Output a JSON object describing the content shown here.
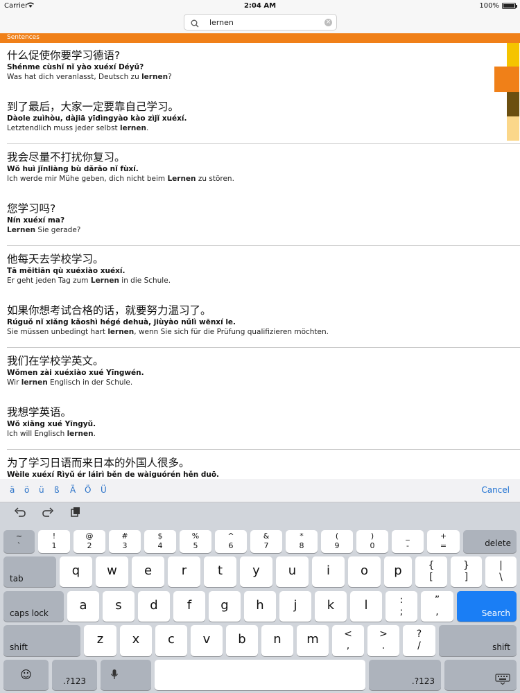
{
  "status": {
    "carrier": "Carrier",
    "time": "2:04 AM",
    "battery": "100%"
  },
  "search": {
    "value": "lernen"
  },
  "section": {
    "title": "Sentences"
  },
  "entries": [
    {
      "zh": "什么促使你要学习德语?",
      "py": "Shénme cùshǐ nǐ yào xuéxí  Déyǔ?",
      "de_pre": "Was hat dich veranlasst, Deutsch zu ",
      "de_bold": "lernen",
      "de_post": "?"
    },
    {
      "zh": "到了最后，大家一定要靠自己学习。",
      "py": "Dàole zuìhòu, dàjiā yīdìngyào kào zìjǐ xuéxí.",
      "de_pre": "Letztendlich muss jeder selbst ",
      "de_bold": "lernen",
      "de_post": "."
    },
    {
      "zh": "我会尽量不打扰你复习。",
      "py": "Wǒ huì jǐnliàng bù dǎrǎo nǐ fùxí.",
      "de_pre": "Ich werde mir Mühe geben, dich nicht beim ",
      "de_bold": "Lernen",
      "de_post": " zu stören."
    },
    {
      "zh": "您学习吗?",
      "py": "Nín xuéxí ma?",
      "de_pre": "",
      "de_bold": "Lernen",
      "de_post": " Sie gerade?"
    },
    {
      "zh": "他每天去学校学习。",
      "py": "Tā měitiān qù xuéxiào xuéxí.",
      "de_pre": "Er geht jeden Tag zum ",
      "de_bold": "Lernen",
      "de_post": " in die Schule."
    },
    {
      "zh": "如果你想考试合格的话，就要努力温习了。",
      "py": "Rúguǒ nǐ xiǎng kǎoshì hégé dehuà, jiùyào nǔlì wēnxí le.",
      "de_pre": "Sie müssen unbedingt hart ",
      "de_bold": "lernen",
      "de_post": ", wenn Sie sich für die Prüfung qualifizieren möchten."
    },
    {
      "zh": "我们在学校学英文。",
      "py": "Wǒmen zài xuéxiào xué  Yīngwén.",
      "de_pre": "Wir ",
      "de_bold": "lernen",
      "de_post": " Englisch in der Schule."
    },
    {
      "zh": "我想学英语。",
      "py": "Wǒ xiǎng xué  Yīngyǔ.",
      "de_pre": "Ich will Englisch ",
      "de_bold": "lernen",
      "de_post": "."
    },
    {
      "zh": "为了学习日语而来日本的外国人很多。",
      "py": "Wèile xuéxí  Rìyǔ ér láirì běn de wàiguórén hěn duō.",
      "de_pre": "",
      "de_bold": "",
      "de_post": ""
    }
  ],
  "strip_colors": [
    "#f5c400",
    "#f08018",
    "#6b4f10",
    "#fbd78a"
  ],
  "keyboard": {
    "accents": [
      "ä",
      "ö",
      "ü",
      "ß",
      "Ä",
      "Ö",
      "Ü"
    ],
    "cancel": "Cancel",
    "toolbar_icons": [
      "undo-icon",
      "redo-icon",
      "paste-icon"
    ],
    "row1": [
      {
        "t": "~",
        "b": "`"
      },
      {
        "t": "!",
        "b": "1"
      },
      {
        "t": "@",
        "b": "2"
      },
      {
        "t": "#",
        "b": "3"
      },
      {
        "t": "$",
        "b": "4"
      },
      {
        "t": "%",
        "b": "5"
      },
      {
        "t": "^",
        "b": "6"
      },
      {
        "t": "&",
        "b": "7"
      },
      {
        "t": "*",
        "b": "8"
      },
      {
        "t": "(",
        "b": "9"
      },
      {
        "t": ")",
        "b": "0"
      },
      {
        "t": "_",
        "b": "-"
      },
      {
        "t": "+",
        "b": "="
      }
    ],
    "delete": "delete",
    "tab": "tab",
    "row2": [
      "q",
      "w",
      "e",
      "r",
      "t",
      "y",
      "u",
      "i",
      "o",
      "p"
    ],
    "row2_sym": [
      {
        "t": "{",
        "b": "["
      },
      {
        "t": "}",
        "b": "]"
      },
      {
        "t": "|",
        "b": "\\"
      }
    ],
    "caps": "caps lock",
    "row3": [
      "a",
      "s",
      "d",
      "f",
      "g",
      "h",
      "j",
      "k",
      "l"
    ],
    "row3_sym": [
      {
        "t": ":",
        "b": ";"
      },
      {
        "t": "”",
        "b": ","
      }
    ],
    "search": "Search",
    "shift": "shift",
    "row4": [
      "z",
      "x",
      "c",
      "v",
      "b",
      "n",
      "m"
    ],
    "row4_sym": [
      {
        "t": "<",
        "b": ","
      },
      {
        "t": ">",
        "b": "."
      },
      {
        "t": "?",
        "b": "/"
      }
    ],
    "num": ".?123"
  }
}
